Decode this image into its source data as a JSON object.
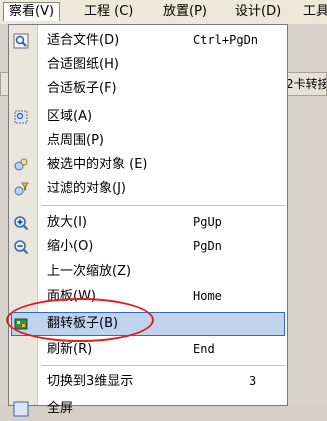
{
  "menubar": {
    "items": [
      {
        "label": "察看(V)"
      },
      {
        "label": "工程 (C)"
      },
      {
        "label": "放置(P)"
      },
      {
        "label": "设计(D)"
      },
      {
        "label": "工具"
      }
    ]
  },
  "background": {
    "toolbar_text": "2卡转接"
  },
  "menu": {
    "items": [
      {
        "label": "适合文件(D)",
        "shortcut": "Ctrl+PgDn",
        "icon": "fit-document-icon"
      },
      {
        "label": "合适图纸(H)",
        "shortcut": "",
        "icon": ""
      },
      {
        "label": "合适板子(F)",
        "shortcut": "",
        "icon": ""
      },
      {
        "label": "区域(A)",
        "shortcut": "",
        "icon": "area-icon"
      },
      {
        "label": "点周围(P)",
        "shortcut": "",
        "icon": ""
      },
      {
        "label": "被选中的对象 (E)",
        "shortcut": "",
        "icon": "selected-objects-icon"
      },
      {
        "label": "过滤的对象(J)",
        "shortcut": "",
        "icon": "filtered-objects-icon"
      },
      {
        "label": "放大(I)",
        "shortcut": "PgUp",
        "icon": "zoom-in-icon"
      },
      {
        "label": "缩小(O)",
        "shortcut": "PgDn",
        "icon": "zoom-out-icon"
      },
      {
        "label": "上一次缩放(Z)",
        "shortcut": "",
        "icon": ""
      },
      {
        "label": "面板(W)",
        "shortcut": "Home",
        "icon": ""
      },
      {
        "label": "翻转板子(B)",
        "shortcut": "",
        "icon": "flip-board-icon",
        "highlighted": true
      },
      {
        "label": "刷新(R)",
        "shortcut": "End",
        "icon": ""
      },
      {
        "label": "切换到3维显示",
        "shortcut": "3",
        "icon": ""
      },
      {
        "label": "全屏",
        "shortcut": "",
        "icon": "fullscreen-icon"
      }
    ]
  },
  "colors": {
    "highlight_bg": "#c1d2ee",
    "highlight_border": "#316ac5",
    "annotation": "#e02020"
  }
}
